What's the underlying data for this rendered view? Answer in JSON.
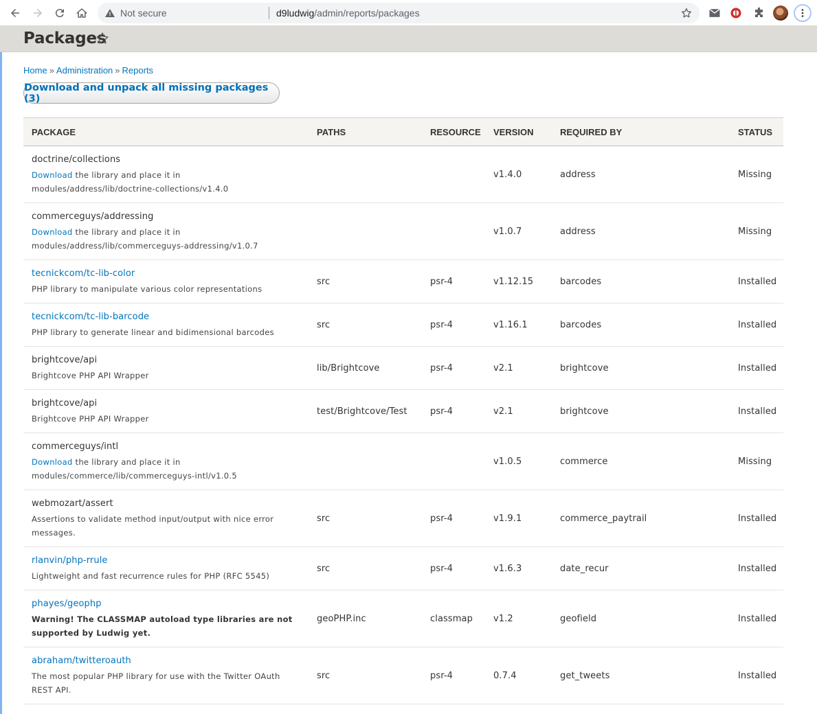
{
  "browser": {
    "security_label": "Not secure",
    "url_host": "d9ludwig",
    "url_path": "/admin/reports/packages"
  },
  "header": {
    "title": "Packages"
  },
  "breadcrumb": {
    "items": [
      "Home",
      "Administration",
      "Reports"
    ],
    "separator": "»"
  },
  "action": {
    "label": "Download and unpack all missing packages (3)"
  },
  "table": {
    "columns": {
      "package": "PACKAGE",
      "paths": "PATHS",
      "resource": "RESOURCE",
      "version": "VERSION",
      "required_by": "REQUIRED BY",
      "status": "STATUS"
    },
    "rows": [
      {
        "name": "doctrine/collections",
        "name_link": false,
        "download_link": "Download",
        "desc": " the library and place it in",
        "desc2": "modules/address/lib/doctrine-collections/v1.4.0",
        "paths": "",
        "resource": "",
        "version": "v1.4.0",
        "required_by": "address",
        "status": "Missing"
      },
      {
        "name": "commerceguys/addressing",
        "name_link": false,
        "download_link": "Download",
        "desc": " the library and place it in",
        "desc2": "modules/address/lib/commerceguys-addressing/v1.0.7",
        "paths": "",
        "resource": "",
        "version": "v1.0.7",
        "required_by": "address",
        "status": "Missing"
      },
      {
        "name": "tecnickcom/tc-lib-color",
        "name_link": true,
        "download_link": "",
        "desc": "PHP library to manipulate various color representations",
        "desc2": "",
        "paths": "src",
        "resource": "psr-4",
        "version": "v1.12.15",
        "required_by": "barcodes",
        "status": "Installed"
      },
      {
        "name": "tecnickcom/tc-lib-barcode",
        "name_link": true,
        "download_link": "",
        "desc": "PHP library to generate linear and bidimensional barcodes",
        "desc2": "",
        "paths": "src",
        "resource": "psr-4",
        "version": "v1.16.1",
        "required_by": "barcodes",
        "status": "Installed"
      },
      {
        "name": "brightcove/api",
        "name_link": false,
        "download_link": "",
        "desc": "Brightcove PHP API Wrapper",
        "desc2": "",
        "paths": "lib/Brightcove",
        "resource": "psr-4",
        "version": "v2.1",
        "required_by": "brightcove",
        "status": "Installed"
      },
      {
        "name": "brightcove/api",
        "name_link": false,
        "download_link": "",
        "desc": "Brightcove PHP API Wrapper",
        "desc2": "",
        "paths": "test/Brightcove/Test",
        "resource": "psr-4",
        "version": "v2.1",
        "required_by": "brightcove",
        "status": "Installed"
      },
      {
        "name": "commerceguys/intl",
        "name_link": false,
        "download_link": "Download",
        "desc": " the library and place it in",
        "desc2": "modules/commerce/lib/commerceguys-intl/v1.0.5",
        "paths": "",
        "resource": "",
        "version": "v1.0.5",
        "required_by": "commerce",
        "status": "Missing"
      },
      {
        "name": "webmozart/assert",
        "name_link": false,
        "download_link": "",
        "desc": "Assertions to validate method input/output with nice error",
        "desc2": "messages.",
        "paths": "src",
        "resource": "psr-4",
        "version": "v1.9.1",
        "required_by": "commerce_paytrail",
        "status": "Installed"
      },
      {
        "name": "rlanvin/php-rrule",
        "name_link": true,
        "download_link": "",
        "desc": "Lightweight and fast recurrence rules for PHP (RFC 5545)",
        "desc2": "",
        "paths": "src",
        "resource": "psr-4",
        "version": "v1.6.3",
        "required_by": "date_recur",
        "status": "Installed"
      },
      {
        "name": "phayes/geophp",
        "name_link": true,
        "download_link": "",
        "desc": "Warning! The CLASSMAP autoload type libraries are not",
        "desc2": "supported by Ludwig yet.",
        "warning": true,
        "paths": "geoPHP.inc",
        "resource": "classmap",
        "version": "v1.2",
        "required_by": "geofield",
        "status": "Installed"
      },
      {
        "name": "abraham/twitteroauth",
        "name_link": true,
        "download_link": "",
        "desc": "The most popular PHP library for use with the Twitter OAuth",
        "desc2": "REST API.",
        "paths": "src",
        "resource": "psr-4",
        "version": "0.7.4",
        "required_by": "get_tweets",
        "status": "Installed"
      }
    ]
  }
}
